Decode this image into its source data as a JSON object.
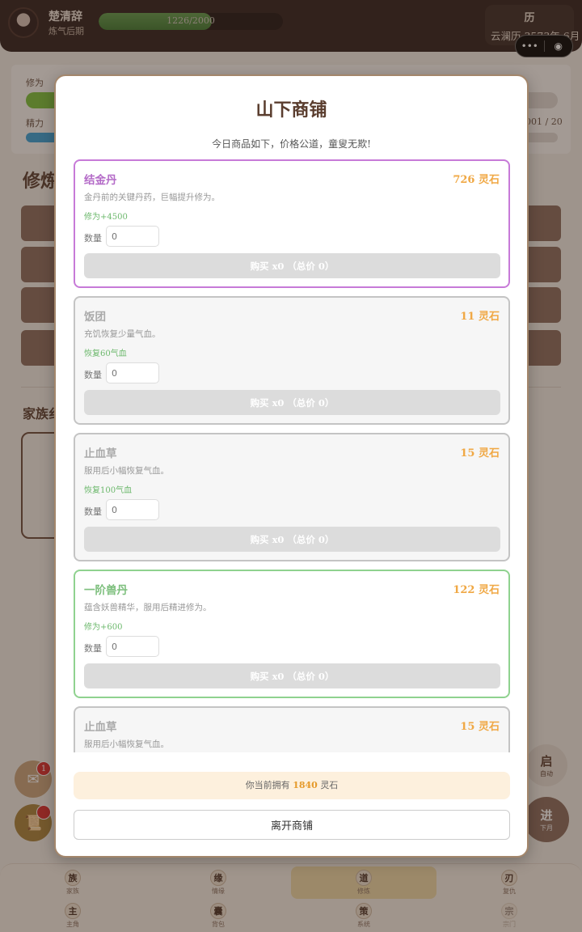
{
  "player": {
    "name": "楚清辞",
    "rank": "炼气后期",
    "xp_text": "1226/2000",
    "xp_progress": 0.613
  },
  "calendar": {
    "icon_label": "历",
    "date": "云澜历 3573年 6月"
  },
  "stats": {
    "cultivation_label": "修为",
    "energy_label": "精力",
    "energy_value": "001 / 20"
  },
  "section": {
    "title": "修炼",
    "family_title": "家族纟"
  },
  "float": {
    "mail_badge": "1"
  },
  "right_buttons": {
    "auto_big": "启",
    "auto_small": "自动",
    "next_big": "进",
    "next_small": "下月"
  },
  "nav": [
    {
      "icon": "族",
      "label": "家族"
    },
    {
      "icon": "缘",
      "label": "情缘"
    },
    {
      "icon": "道",
      "label": "修炼"
    },
    {
      "icon": "刃",
      "label": "复仇"
    },
    {
      "icon": "主",
      "label": "主角"
    },
    {
      "icon": "囊",
      "label": "背包"
    },
    {
      "icon": "策",
      "label": "系统"
    },
    {
      "icon": "宗",
      "label": "宗门"
    }
  ],
  "shop": {
    "title": "山下商铺",
    "subtitle": "今日商品如下，价格公道，童叟无欺!",
    "quantity_label": "数量",
    "quantity_placeholder": "0",
    "items": [
      {
        "name": "结金丹",
        "price": "726 灵石",
        "desc": "金丹前的关键丹药，巨幅提升修为。",
        "effect": "修为+4500",
        "buy": "购买 x0 （总价 0）"
      },
      {
        "name": "饭团",
        "price": "11 灵石",
        "desc": "充饥恢复少量气血。",
        "effect": "恢复60气血",
        "buy": "购买 x0 （总价 0）"
      },
      {
        "name": "止血草",
        "price": "15 灵石",
        "desc": "服用后小幅恢复气血。",
        "effect": "恢复100气血",
        "buy": "购买 x0 （总价 0）"
      },
      {
        "name": "一阶兽丹",
        "price": "122 灵石",
        "desc": "蕴含妖兽精华，服用后精进修为。",
        "effect": "修为+600",
        "buy": "购买 x0 （总价 0）"
      },
      {
        "name": "止血草",
        "price": "15 灵石",
        "desc": "服用后小幅恢复气血。"
      }
    ],
    "balance_prefix": "你当前拥有",
    "balance_amount": "1840",
    "balance_suffix": "灵石",
    "leave": "离开商铺"
  }
}
